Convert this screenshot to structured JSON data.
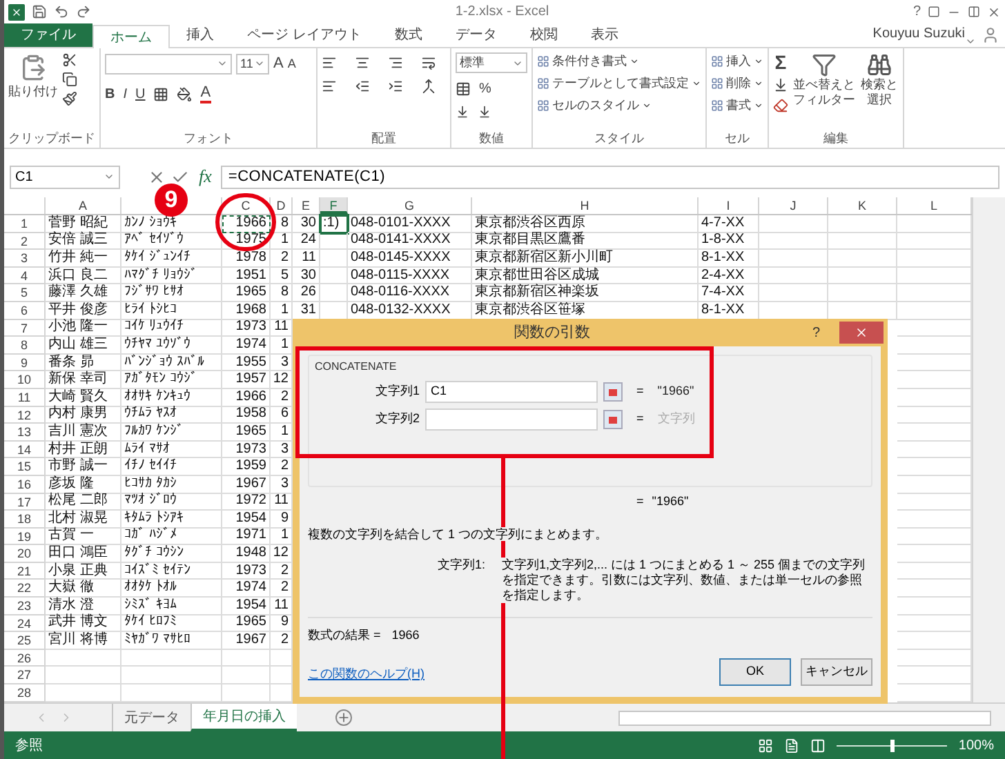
{
  "window": {
    "title": "1-2.xlsx - Excel",
    "help": "?"
  },
  "tabs": [
    {
      "label": "ファイル",
      "kind": "file",
      "selected": false
    },
    {
      "label": "ホーム",
      "kind": "tab",
      "selected": true
    },
    {
      "label": "挿入",
      "kind": "tab",
      "selected": false
    },
    {
      "label": "ページ レイアウト",
      "kind": "tab",
      "selected": false
    },
    {
      "label": "数式",
      "kind": "tab",
      "selected": false
    },
    {
      "label": "データ",
      "kind": "tab",
      "selected": false
    },
    {
      "label": "校閲",
      "kind": "tab",
      "selected": false
    },
    {
      "label": "表示",
      "kind": "tab",
      "selected": false
    }
  ],
  "user": {
    "name": "Kouyuu Suzuki"
  },
  "ribbon": {
    "groups": [
      {
        "label": "クリップボード",
        "kind": "clipboard",
        "buttons": [
          "貼り付け"
        ]
      },
      {
        "label": "フォント",
        "kind": "font",
        "size": "11",
        "size_buttons": [
          "A",
          "A"
        ],
        "styles": [
          "B",
          "I",
          "U"
        ],
        "color_button": "A"
      },
      {
        "label": "配置",
        "kind": "alignment"
      },
      {
        "label": "数値",
        "kind": "number",
        "format": "標準",
        "symbol": "%"
      },
      {
        "label": "スタイル",
        "kind": "styles",
        "buttons": [
          "条件付き書式",
          "テーブルとして書式設定",
          "セルのスタイル"
        ]
      },
      {
        "label": "セル",
        "kind": "cells",
        "buttons": [
          "挿入",
          "削除",
          "書式"
        ]
      },
      {
        "label": "編集",
        "kind": "editing",
        "symbol": "Σ",
        "buttons": [
          "並べ替えとフィルター",
          "検索と選択"
        ]
      }
    ]
  },
  "formula_bar": {
    "name_box": "C1",
    "fx": "fx",
    "formula": "=CONCATENATE(C1)"
  },
  "sheet": {
    "columns": [
      {
        "label": "A",
        "selected": false
      },
      {
        "selected": false
      },
      {
        "label": "C",
        "selected": false
      },
      {
        "label": "D",
        "selected": false
      },
      {
        "label": "E",
        "selected": false
      },
      {
        "label": "F",
        "selected": true
      },
      {
        "label": "G",
        "selected": false
      },
      {
        "label": "H",
        "selected": false
      },
      {
        "label": "I",
        "selected": false
      },
      {
        "label": "J",
        "selected": false
      },
      {
        "label": "K",
        "selected": false
      },
      {
        "label": "L",
        "selected": false
      }
    ],
    "rows": [
      {
        "number": "1",
        "name": "菅野 昭紀",
        "kana": "ｶﾝﾉ ｼｮｳｷ",
        "year": "1966",
        "month": "8",
        "day": "30",
        "note": ":1)",
        "phone": "048-0101-XXXX",
        "address": "東京都渋谷区西原",
        "block": "4-7-XX"
      },
      {
        "number": "2",
        "name": "安倍 誠三",
        "kana": "ｱﾍﾞ ｾｲｿﾞｳ",
        "year": "1975",
        "month": "1",
        "day": "24",
        "phone": "048-0141-XXXX",
        "address": "東京都目黒区鷹番",
        "block": "1-8-XX"
      },
      {
        "number": "3",
        "name": "竹井 純一",
        "kana": "ﾀｹｲ ｼﾞｭﾝｲﾁ",
        "year": "1978",
        "month": "2",
        "day": "11",
        "phone": "048-0145-XXXX",
        "address": "東京都新宿区新小川町",
        "block": "8-1-XX"
      },
      {
        "number": "4",
        "name": "浜口 良二",
        "kana": "ﾊﾏｸﾞﾁ ﾘｮｳｼﾞ",
        "year": "1951",
        "month": "5",
        "day": "30",
        "phone": "048-0115-XXXX",
        "address": "東京都世田谷区成城",
        "block": "2-4-XX"
      },
      {
        "number": "5",
        "name": "藤澤 久雄",
        "kana": "ﾌｼﾞｻﾜ ﾋｻｵ",
        "year": "1965",
        "month": "8",
        "day": "26",
        "phone": "048-0116-XXXX",
        "address": "東京都新宿区神楽坂",
        "block": "7-4-XX"
      },
      {
        "number": "6",
        "name": "平井 俊彦",
        "kana": "ﾋﾗｲ ﾄｼﾋｺ",
        "year": "1968",
        "month": "1",
        "day": "31",
        "phone": "048-0132-XXXX",
        "address": "東京都渋谷区笹塚",
        "block": "8-1-XX"
      },
      {
        "number": "7",
        "name": "小池 隆一",
        "kana": "ｺｲｹ ﾘｭｳｲﾁ",
        "year": "1973",
        "month": "11"
      },
      {
        "number": "8",
        "name": "内山 雄三",
        "kana": "ｳﾁﾔﾏ ﾕｳｿﾞｳ",
        "year": "1974",
        "month": "1"
      },
      {
        "number": "9",
        "name": "番条 昴",
        "kana": "ﾊﾞﾝｼﾞｮｳ ｽﾊﾞﾙ",
        "year": "1955",
        "month": "3"
      },
      {
        "number": "10",
        "name": "新保 幸司",
        "kana": "ｱｶﾞﾀﾓﾝ ｺｳｼﾞ",
        "year": "1957",
        "month": "12"
      },
      {
        "number": "11",
        "name": "大崎 賢久",
        "kana": "ｵｵｻｷ ｹﾝｷｭｳ",
        "year": "1966",
        "month": "2"
      },
      {
        "number": "12",
        "name": "内村 康男",
        "kana": "ｳﾁﾑﾗ ﾔｽｵ",
        "year": "1958",
        "month": "6"
      },
      {
        "number": "13",
        "name": "吉川 憲次",
        "kana": "ﾌﾙｶﾜ ｹﾝｼﾞ",
        "year": "1965",
        "month": "1"
      },
      {
        "number": "14",
        "name": "村井 正朗",
        "kana": "ﾑﾗｲ ﾏｻｵ",
        "year": "1973",
        "month": "3"
      },
      {
        "number": "15",
        "name": "市野 誠一",
        "kana": "ｲﾁﾉ ｾｲｲﾁ",
        "year": "1959",
        "month": "2"
      },
      {
        "number": "16",
        "name": "彦坂 隆",
        "kana": "ﾋｺｻｶ ﾀｶｼ",
        "year": "1967",
        "month": "3"
      },
      {
        "number": "17",
        "name": "松尾 二郎",
        "kana": "ﾏﾂｵ ｼﾞﾛｳ",
        "year": "1972",
        "month": "11"
      },
      {
        "number": "18",
        "name": "北村 淑晃",
        "kana": "ｷﾀﾑﾗ ﾄｼｱｷ",
        "year": "1954",
        "month": "9"
      },
      {
        "number": "19",
        "name": "古賀 一",
        "kana": "ｺｶﾞ ﾊｼﾞﾒ",
        "year": "1971",
        "month": "1"
      },
      {
        "number": "20",
        "name": "田口 鴻臣",
        "kana": "ﾀｸﾞﾁ ｺｳｼﾝ",
        "year": "1948",
        "month": "12"
      },
      {
        "number": "21",
        "name": "小泉 正典",
        "kana": "ｺｲｽﾞﾐ ｾｲﾃﾝ",
        "year": "1973",
        "month": "2"
      },
      {
        "number": "22",
        "name": "大嶽 徹",
        "kana": "ｵｵﾀｹ ﾄｵﾙ",
        "year": "1974",
        "month": "2"
      },
      {
        "number": "23",
        "name": "清水 澄",
        "kana": "ｼﾐｽﾞ ｷﾖﾑ",
        "year": "1954",
        "month": "11"
      },
      {
        "number": "24",
        "name": "武井 博文",
        "kana": "ﾀｹｲ ﾋﾛﾌﾐ",
        "year": "1965",
        "month": "9"
      },
      {
        "number": "25",
        "name": "宮川 将博",
        "kana": "ﾐﾔｶﾞﾜ ﾏｻﾋﾛ",
        "year": "1967",
        "month": "2"
      },
      {
        "number": "26"
      },
      {
        "number": "27"
      },
      {
        "number": "28"
      }
    ]
  },
  "sheet_tabs": [
    {
      "label": "元データ",
      "selected": false
    },
    {
      "label": "年月日の挿入",
      "selected": true
    }
  ],
  "status_bar": {
    "mode": "参照",
    "zoom_slider": {
      "level": 0.5
    },
    "zoom": "100%"
  },
  "dialog": {
    "title": "関数の引数",
    "help": "?",
    "function": "CONCATENATE",
    "args": [
      {
        "label": "文字列1",
        "value": "C1",
        "equals": "=",
        "result": "\"1966\"",
        "kind": "value"
      },
      {
        "label": "文字列2",
        "equals": "=",
        "result": "文字列",
        "kind": "hint"
      }
    ],
    "equals": "=",
    "result": "\"1966\"",
    "description": "複数の文字列を結合して 1 つの文字列にまとめます。",
    "arg_help_label": "文字列1:",
    "arg_help": "文字列1,文字列2,... には 1 つにまとめる 1 ～ 255 個までの文字列を指定できます。引数には文字列、数値、または単一セルの参照を指定します。",
    "formula_result_label": "数式の結果 =",
    "formula_result": "1966",
    "help_link": "この関数のヘルプ(H)",
    "buttons": [
      "OK",
      "キャンセル"
    ]
  },
  "annotation": {
    "step": "9"
  }
}
